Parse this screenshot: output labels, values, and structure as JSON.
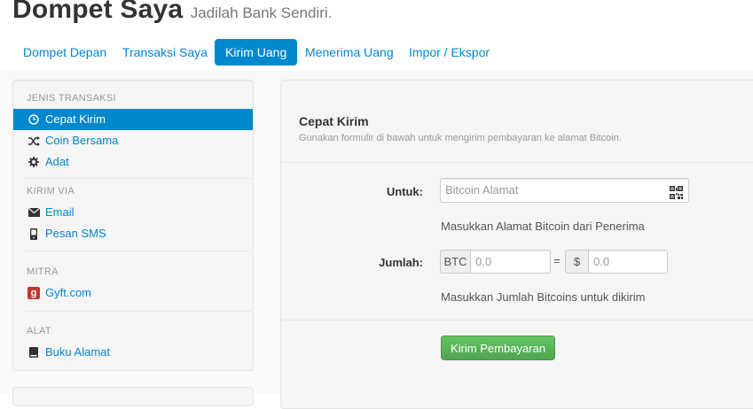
{
  "header": {
    "title": "Dompet Saya",
    "subtitle": "Jadilah Bank Sendiri."
  },
  "nav": {
    "items": [
      {
        "label": "Dompet Depan"
      },
      {
        "label": "Transaksi Saya"
      },
      {
        "label": "Kirim Uang"
      },
      {
        "label": "Menerima Uang"
      },
      {
        "label": "Impor / Ekspor"
      }
    ],
    "active": "Kirim Uang"
  },
  "sidebar": {
    "sections": [
      {
        "header": "JENIS TRANSAKSI",
        "items": [
          {
            "label": "Cepat Kirim",
            "icon": "clock-icon"
          },
          {
            "label": "Coin Bersama",
            "icon": "shuffle-icon"
          },
          {
            "label": "Adat",
            "icon": "gear-icon"
          }
        ]
      },
      {
        "header": "KIRIM VIA",
        "items": [
          {
            "label": "Email",
            "icon": "envelope-icon"
          },
          {
            "label": "Pesan SMS",
            "icon": "phone-icon"
          }
        ]
      },
      {
        "header": "MITRA",
        "items": [
          {
            "label": "Gyft.com",
            "icon": "gyft-icon"
          }
        ]
      },
      {
        "header": "ALAT",
        "items": [
          {
            "label": "Buku Alamat",
            "icon": "book-icon"
          }
        ]
      }
    ],
    "active": "Cepat Kirim",
    "gyft_letter": "g"
  },
  "main": {
    "title": "Cepat Kirim",
    "description": "Gunakan formulir di bawah untuk mengirim pembayaran ke alamat Bitcoin.",
    "to_label": "Untuk:",
    "to_placeholder": "Bitcoin Alamat",
    "to_help": "Masukkan Alamat Bitcoin dari Penerima",
    "amount_label": "Jumlah:",
    "btc_addon": "BTC",
    "btc_placeholder": "0.0",
    "equals": "=",
    "usd_addon": "$",
    "usd_placeholder": "0.0",
    "amount_help": "Masukkan Jumlah Bitcoins untuk dikirim",
    "submit_label": "Kirim Pembayaran"
  },
  "colors": {
    "accent": "#0088cc",
    "success": "#51a351",
    "gyft": "#c0392b"
  }
}
